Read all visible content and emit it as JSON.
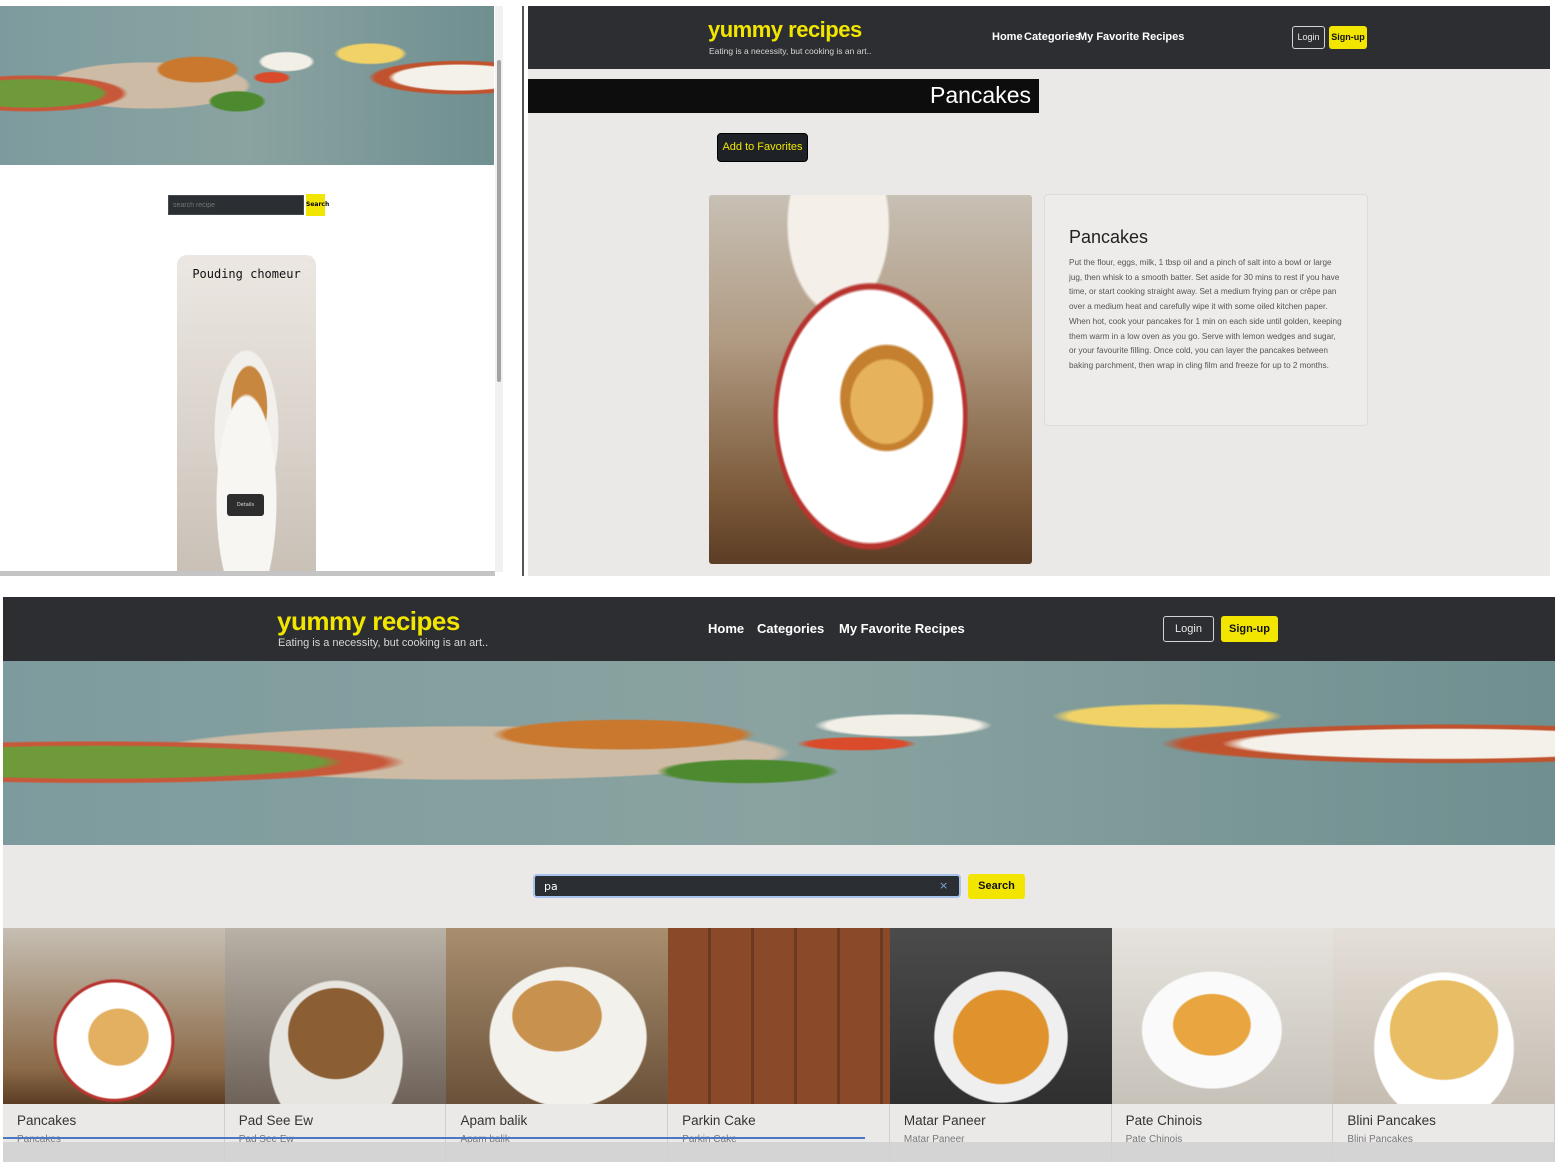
{
  "brand": {
    "name": "yummy recipes",
    "tagline": "Eating is a necessity, but cooking is an art..",
    "accent_color": "#f2e600",
    "nav_color": "#2c2e31"
  },
  "nav": {
    "home": "Home",
    "categories": "Categories",
    "favorites": "My Favorite Recipes",
    "login": "Login",
    "signup": "Sign-up"
  },
  "small_window": {
    "search_placeholder": "search recipe",
    "search_button": "Search",
    "card_title": "Pouding chomeur",
    "card_button": "Details"
  },
  "detail_window": {
    "page_title": "Pancakes",
    "add_favorites": "Add to Favorites",
    "recipe_title": "Pancakes",
    "recipe_text": "Put the flour, eggs, milk, 1 tbsp oil and a pinch of salt into a bowl or large jug, then whisk to a smooth batter. Set aside for 30 mins to rest if you have time, or start cooking straight away. Set a medium frying pan or crêpe pan over a medium heat and carefully wipe it with some oiled kitchen paper. When hot, cook your pancakes for 1 min on each side until golden, keeping them warm in a low oven as you go. Serve with lemon wedges and sugar, or your favourite filling. Once cold, you can layer the pancakes between baking parchment, then wrap in cling film and freeze for up to 2 months."
  },
  "search_window": {
    "query": "pa",
    "clear_icon": "×",
    "search_button": "Search",
    "results": [
      {
        "title": "Pancakes",
        "subtitle": "Pancakes"
      },
      {
        "title": "Pad See Ew",
        "subtitle": "Pad See Ew"
      },
      {
        "title": "Apam balik",
        "subtitle": "Apam balik"
      },
      {
        "title": "Parkin Cake",
        "subtitle": "Parkin Cake"
      },
      {
        "title": "Matar Paneer",
        "subtitle": "Matar Paneer"
      },
      {
        "title": "Pate Chinois",
        "subtitle": "Pate Chinois"
      },
      {
        "title": "Blini Pancakes",
        "subtitle": "Blini Pancakes"
      }
    ]
  }
}
